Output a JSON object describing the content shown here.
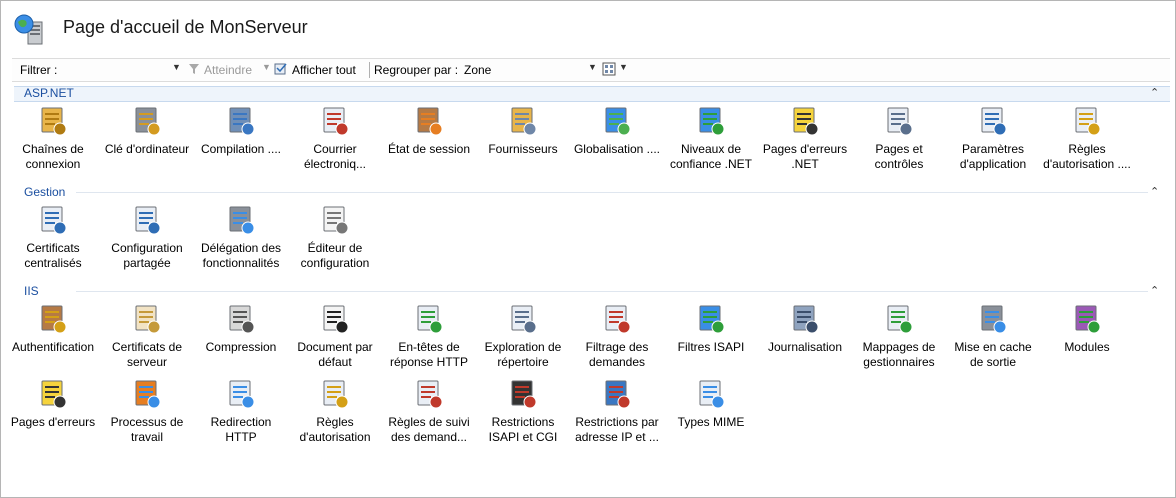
{
  "header": {
    "title": "Page d'accueil de MonServeur",
    "icon": "server-globe-icon"
  },
  "toolbar": {
    "filter_label": "Filtrer :",
    "filter_value": "",
    "go_label": "Atteindre",
    "show_all_label": "Afficher tout",
    "group_by_label": "Regrouper par :",
    "group_by_value": "Zone"
  },
  "groups": [
    {
      "name": "ASP.NET",
      "items": [
        {
          "label": "Chaînes de connexion",
          "icon": "database-icon"
        },
        {
          "label": "Clé d'ordinateur",
          "icon": "key-server-icon"
        },
        {
          "label": "Compilation ....",
          "icon": "stack-download-icon"
        },
        {
          "label": "Courrier électroniq...",
          "icon": "mail-icon"
        },
        {
          "label": "État de session",
          "icon": "user-state-icon"
        },
        {
          "label": "Fournisseurs",
          "icon": "providers-icon"
        },
        {
          "label": "Globalisation ....",
          "icon": "globe-icon"
        },
        {
          "label": "Niveaux de confiance .NET",
          "icon": "globe-check-icon"
        },
        {
          "label": "Pages d'erreurs .NET",
          "icon": "error-404-icon"
        },
        {
          "label": "Pages et contrôles",
          "icon": "page-controls-icon"
        },
        {
          "label": "Paramètres d'application",
          "icon": "checklist-icon"
        },
        {
          "label": "Règles d'autorisation ....",
          "icon": "list-lock-icon"
        }
      ]
    },
    {
      "name": "Gestion",
      "items": [
        {
          "label": "Certificats centralisés",
          "icon": "certificate-list-icon"
        },
        {
          "label": "Configuration partagée",
          "icon": "checklist-icon"
        },
        {
          "label": "Délégation des fonctionnalités",
          "icon": "delegation-icon"
        },
        {
          "label": "Éditeur de configuration",
          "icon": "document-icon"
        }
      ]
    },
    {
      "name": "IIS",
      "items": [
        {
          "label": "Authentification",
          "icon": "user-lock-icon"
        },
        {
          "label": "Certificats de serveur",
          "icon": "certificates-icon"
        },
        {
          "label": "Compression",
          "icon": "compression-icon"
        },
        {
          "label": "Document par défaut",
          "icon": "default-document-icon"
        },
        {
          "label": "En-têtes de réponse HTTP",
          "icon": "http-headers-icon"
        },
        {
          "label": "Exploration de répertoire",
          "icon": "directory-browse-icon"
        },
        {
          "label": "Filtrage des demandes",
          "icon": "request-filter-icon"
        },
        {
          "label": "Filtres ISAPI",
          "icon": "isapi-filter-icon"
        },
        {
          "label": "Journalisation",
          "icon": "log-book-icon"
        },
        {
          "label": "Mappages de gestionnaires",
          "icon": "handler-mapping-icon"
        },
        {
          "label": "Mise en cache de sortie",
          "icon": "output-cache-icon"
        },
        {
          "label": "Modules",
          "icon": "modules-icon"
        },
        {
          "label": "Pages d'erreurs",
          "icon": "error-404-icon"
        },
        {
          "label": "Processus de travail",
          "icon": "worker-process-icon"
        },
        {
          "label": "Redirection HTTP",
          "icon": "redirect-icon"
        },
        {
          "label": "Règles d'autorisation",
          "icon": "list-lock-icon"
        },
        {
          "label": "Règles de suivi des demand...",
          "icon": "failed-request-icon"
        },
        {
          "label": "Restrictions ISAPI et CGI",
          "icon": "cgi-restriction-icon"
        },
        {
          "label": "Restrictions par adresse IP et ...",
          "icon": "ip-restriction-icon"
        },
        {
          "label": "Types MIME",
          "icon": "mime-types-icon"
        }
      ]
    }
  ]
}
